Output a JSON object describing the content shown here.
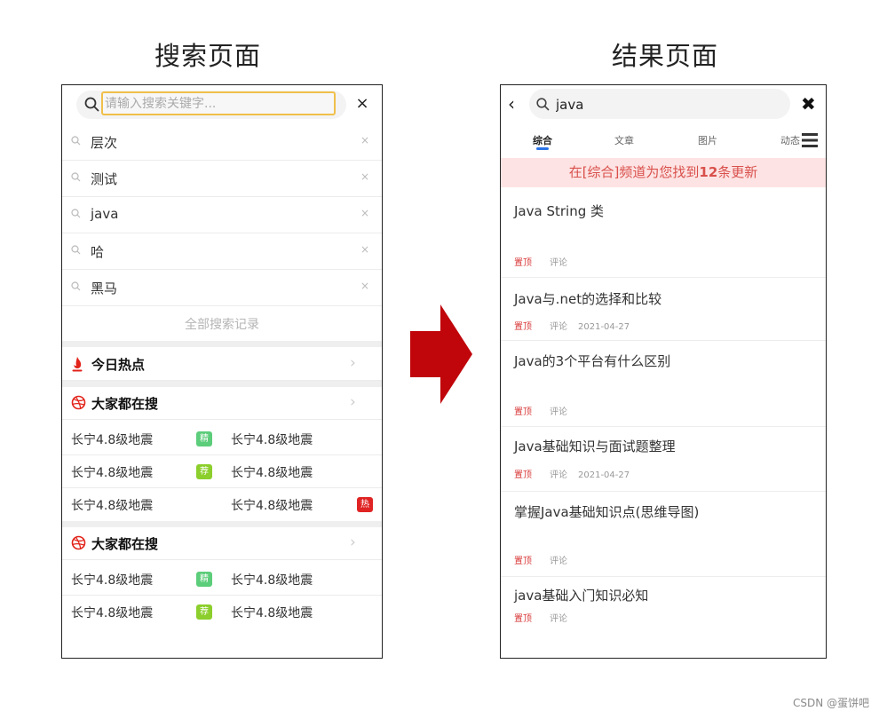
{
  "labels": {
    "search_title": "搜索页面",
    "result_title": "结果页面"
  },
  "search_page": {
    "placeholder": "请输入搜索关键字...",
    "close_label": "×",
    "history": [
      "层次",
      "测试",
      "java",
      "哈",
      "黑马"
    ],
    "history_delete_label": "×",
    "all_records_label": "全部搜索记录",
    "today_hot": {
      "label": "今日热点",
      "chevron": "›"
    },
    "everyone_searching_1": {
      "label": "大家都在搜",
      "chevron": "›",
      "rows": [
        {
          "left": "长宁4.8级地震",
          "left_tag": "精",
          "right": "长宁4.8级地震",
          "right_tag": ""
        },
        {
          "left": "长宁4.8级地震",
          "left_tag": "荐",
          "right": "长宁4.8级地震",
          "right_tag": ""
        },
        {
          "left": "长宁4.8级地震",
          "left_tag": "",
          "right": "长宁4.8级地震",
          "right_tag": "热"
        }
      ]
    },
    "everyone_searching_2": {
      "label": "大家都在搜",
      "chevron": "›",
      "rows": [
        {
          "left": "长宁4.8级地震",
          "left_tag": "精",
          "right": "长宁4.8级地震",
          "right_tag": ""
        },
        {
          "left": "长宁4.8级地震",
          "left_tag": "荐",
          "right": "长宁4.8级地震",
          "right_tag": ""
        }
      ]
    }
  },
  "result_page": {
    "back_label": "‹",
    "query": "java",
    "close_label": "✖",
    "tabs": [
      "综合",
      "文章",
      "图片",
      "动态"
    ],
    "active_tab": "综合",
    "banner": {
      "prefix": "在[综合]频道为您找到",
      "count": "12",
      "suffix": "条更新"
    },
    "results": [
      {
        "title": "Java String 类",
        "top": "置顶",
        "comment": "评论",
        "date": ""
      },
      {
        "title": "Java与.net的选择和比较",
        "top": "置顶",
        "comment": "评论",
        "date": "2021-04-27"
      },
      {
        "title": "Java的3个平台有什么区别",
        "top": "置顶",
        "comment": "评论",
        "date": ""
      },
      {
        "title": "Java基础知识与面试题整理",
        "top": "置顶",
        "comment": "评论",
        "date": "2021-04-27"
      },
      {
        "title": "掌握Java基础知识点(思维导图)",
        "top": "置顶",
        "comment": "评论",
        "date": ""
      },
      {
        "title": "java基础入门知识必知",
        "top": "置顶",
        "comment": "评论",
        "date": ""
      }
    ]
  },
  "tag_colors": {
    "精": "#5ccd7a",
    "荐": "#8ccf2c",
    "热": "#e02424"
  },
  "icons": {
    "flame": "flame-icon",
    "dribbble": "dribbble-icon",
    "arrow": "right-arrow-icon"
  },
  "colors": {
    "arrow": "#c0060b",
    "banner_bg": "#fde3e3",
    "banner_text": "#d9504c",
    "tab_underline": "#2a73e8"
  },
  "watermark": "CSDN @蛋饼吧"
}
